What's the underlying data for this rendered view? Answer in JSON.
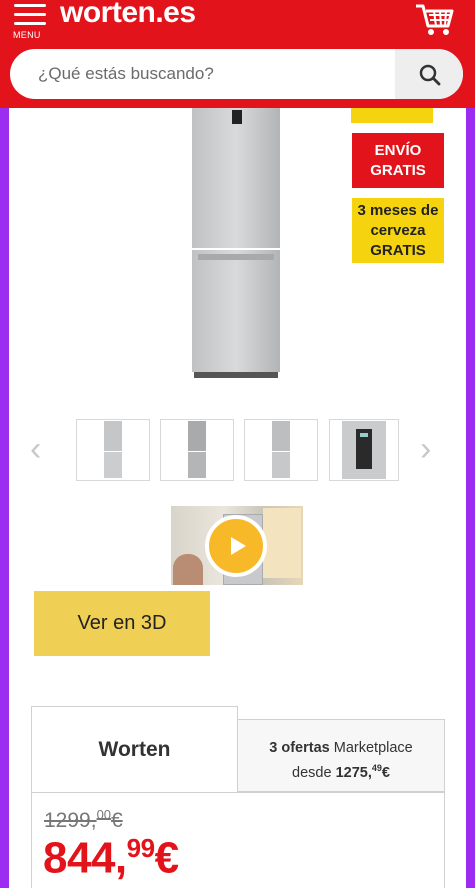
{
  "header": {
    "menu_label": "MENU",
    "logo": "worten.es",
    "cart_icon": "cart-icon",
    "menu_icon": "hamburger-icon",
    "brand_color": "#e3131b"
  },
  "search": {
    "placeholder": "¿Qué estás buscando?",
    "value": "",
    "icon": "search-icon"
  },
  "badges": {
    "shipping": "ENVÍO GRATIS",
    "promo": "3 meses de cerveza GRATIS"
  },
  "gallery": {
    "prev_icon": "chevron-left-icon",
    "next_icon": "chevron-right-icon",
    "thumbnails": [
      "fridge-front",
      "fridge-angle",
      "fridge-side",
      "fridge-panel"
    ],
    "video_icon": "play-icon"
  },
  "view_3d_label": "Ver en 3D",
  "offers": {
    "worten_tab": "Worten",
    "market_count": "3 ofertas",
    "market_word": "Marketplace",
    "market_from": "desde",
    "market_price_int": "1275,",
    "market_price_dec": "49",
    "market_currency": "€"
  },
  "price": {
    "old_int": "1299,",
    "old_dec": "00",
    "old_currency": "€",
    "new_int": "844,",
    "new_dec": "99",
    "new_currency": "€"
  },
  "colors": {
    "accent_red": "#e3131b",
    "accent_yellow": "#f5d40f",
    "button_3d": "#f0cf55",
    "play": "#f7b928",
    "side_purple": "#9b2cf0"
  }
}
